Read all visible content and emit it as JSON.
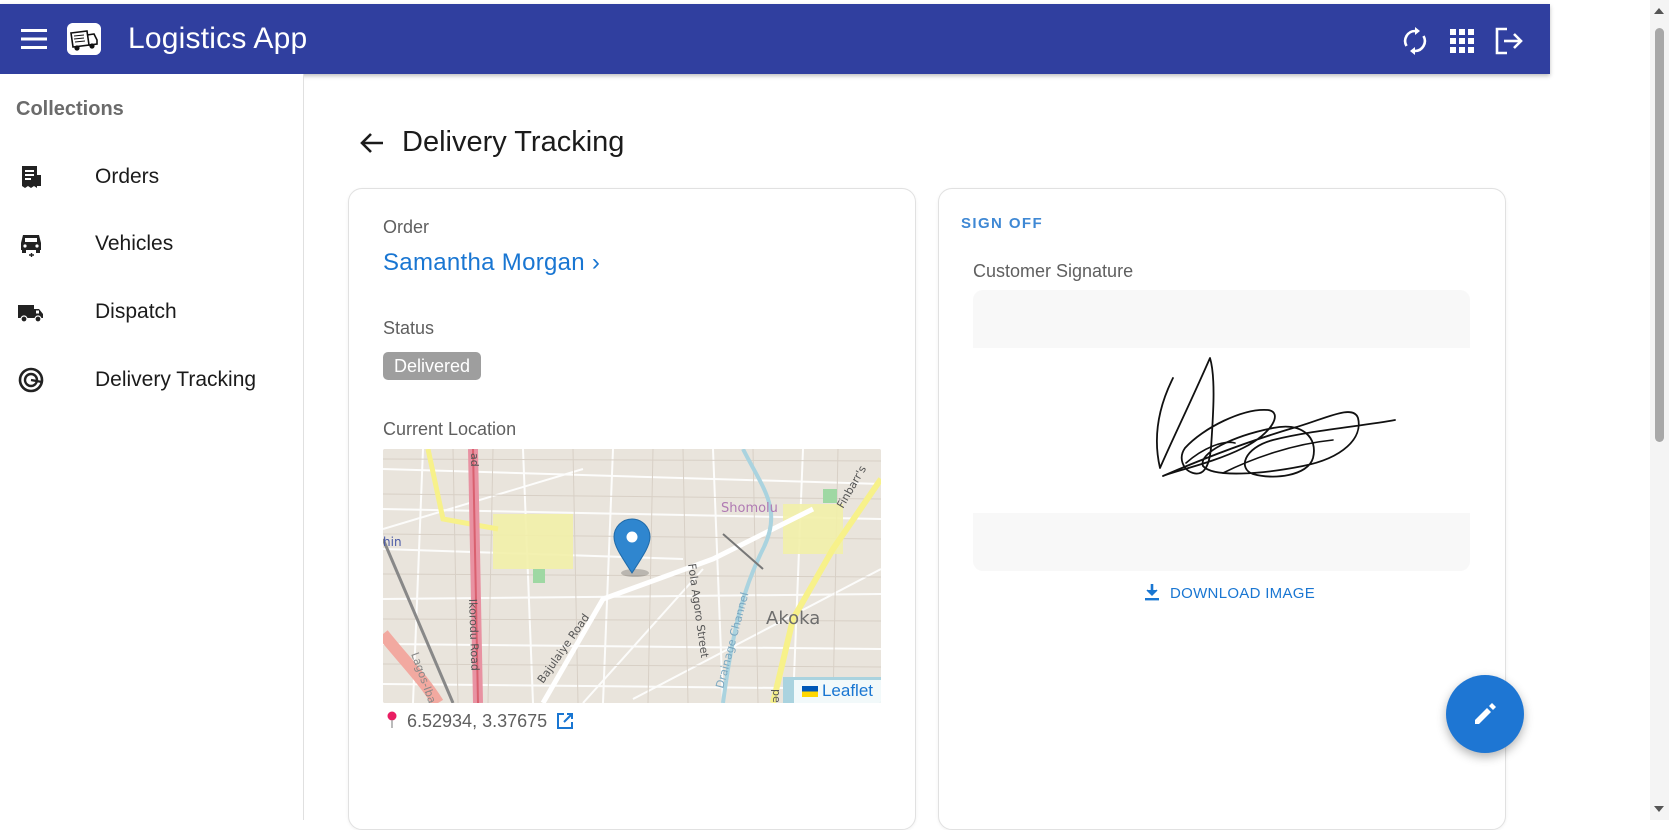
{
  "app": {
    "title": "Logistics App",
    "bar_color": "#303f9f",
    "accent": "#1976d2"
  },
  "header_actions": [
    {
      "icon": "sync-icon"
    },
    {
      "icon": "apps-grid-icon"
    },
    {
      "icon": "logout-icon"
    }
  ],
  "sidebar": {
    "heading": "Collections",
    "items": [
      {
        "label": "Orders",
        "icon": "receipt-icon"
      },
      {
        "label": "Vehicles",
        "icon": "car-icon"
      },
      {
        "label": "Dispatch",
        "icon": "truck-icon"
      },
      {
        "label": "Delivery Tracking",
        "icon": "target-icon"
      }
    ]
  },
  "page": {
    "title": "Delivery Tracking"
  },
  "details": {
    "order_label": "Order",
    "order_value": "Samantha Morgan",
    "order_chevron": "›",
    "status_label": "Status",
    "status_value": "Delivered",
    "location_label": "Current Location",
    "coordinates": "6.52934, 3.37675",
    "map": {
      "attribution": "Leaflet",
      "place_labels": [
        "Shomolu",
        "Akoka",
        "Finbarr's",
        "Ikorodu Road",
        "Bajulaiye Road",
        "Fola Agoro Street",
        "Drainage Channel",
        "Lagos-Ibadan",
        "hin",
        "pe",
        "ad"
      ]
    }
  },
  "sign_off": {
    "section_title": "SIGN OFF",
    "signature_label": "Customer Signature",
    "download_label": "DOWNLOAD IMAGE"
  },
  "fab": {
    "icon": "edit-pencil-icon"
  }
}
